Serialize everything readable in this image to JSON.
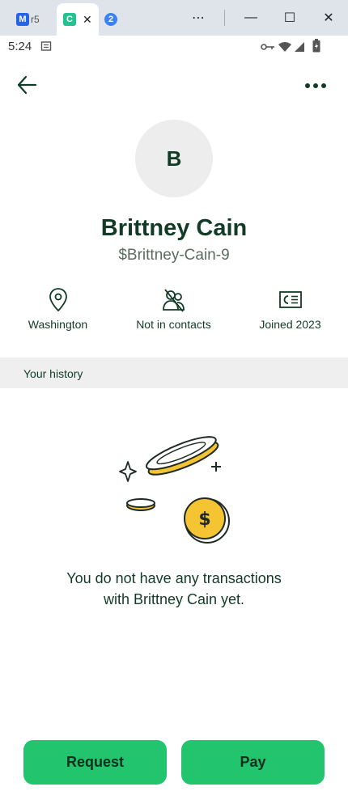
{
  "browser": {
    "tabs": [
      {
        "label": "r5",
        "icon": "m-app-icon"
      },
      {
        "label": "",
        "icon": "cash-app-icon",
        "active": true
      },
      {
        "label": "2",
        "icon": "number-badge-icon"
      }
    ],
    "favicon_letters": {
      "cash": "C",
      "m": "M"
    }
  },
  "status_bar": {
    "time": "5:24"
  },
  "profile": {
    "avatar_initial": "B",
    "name": "Brittney Cain",
    "handle": "$Brittney-Cain-9",
    "info": [
      {
        "icon": "location-pin-icon",
        "label": "Washington"
      },
      {
        "icon": "not-in-contacts-icon",
        "label": "Not in contacts"
      },
      {
        "icon": "id-card-icon",
        "label": "Joined 2023"
      }
    ]
  },
  "history": {
    "title": "Your history",
    "empty_line1": "You do not have any transactions",
    "empty_line2": "with Brittney Cain yet."
  },
  "actions": {
    "request_label": "Request",
    "pay_label": "Pay"
  },
  "colors": {
    "accent": "#22c56d",
    "text": "#123b27",
    "coin": "#f5c432"
  }
}
